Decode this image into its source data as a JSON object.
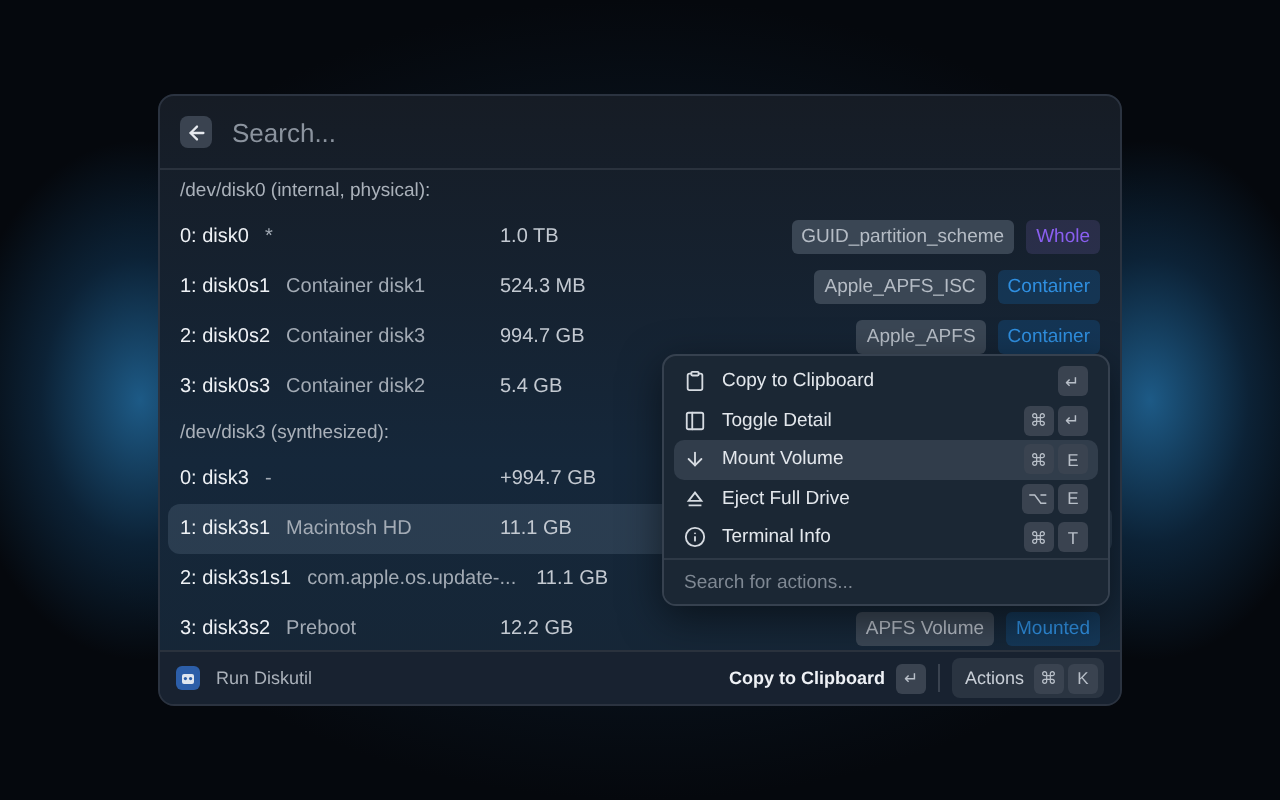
{
  "search": {
    "placeholder": "Search..."
  },
  "sections": [
    {
      "title": "/dev/disk0 (internal, physical):",
      "rows": [
        {
          "name": "0: disk0",
          "description": "*",
          "size": "1.0 TB",
          "selected": false,
          "tags": [
            {
              "label": "GUID_partition_scheme",
              "kind": "plain"
            },
            {
              "label": "Whole",
              "kind": "purple"
            }
          ]
        },
        {
          "name": "1: disk0s1",
          "description": "Container disk1",
          "size": "524.3 MB",
          "selected": false,
          "tags": [
            {
              "label": "Apple_APFS_ISC",
              "kind": "plain"
            },
            {
              "label": "Container",
              "kind": "blue"
            }
          ]
        },
        {
          "name": "2: disk0s2",
          "description": "Container disk3",
          "size": "994.7 GB",
          "selected": false,
          "tags": [
            {
              "label": "Apple_APFS",
              "kind": "plain"
            },
            {
              "label": "Container",
              "kind": "blue"
            }
          ]
        },
        {
          "name": "3: disk0s3",
          "description": "Container disk2",
          "size": "5.4 GB",
          "selected": false,
          "tags": []
        }
      ]
    },
    {
      "title": "/dev/disk3 (synthesized):",
      "rows": [
        {
          "name": "0: disk3",
          "description": "-",
          "size": "+994.7 GB",
          "selected": false,
          "tags": []
        },
        {
          "name": "1: disk3s1",
          "description": "Macintosh HD",
          "size": "11.1 GB",
          "selected": true,
          "tags": []
        },
        {
          "name": "2: disk3s1s1",
          "description": "com.apple.os.update-...",
          "size": "11.1 GB",
          "selected": false,
          "tags": []
        },
        {
          "name": "3: disk3s2",
          "description": "Preboot",
          "size": "12.2 GB",
          "selected": false,
          "tags": [
            {
              "label": "APFS Volume",
              "kind": "plain"
            },
            {
              "label": "Mounted",
              "kind": "blue"
            }
          ]
        }
      ]
    }
  ],
  "actions_menu": {
    "items": [
      {
        "label": "Copy to Clipboard",
        "kind": "clipboard",
        "selected": false,
        "keys": [
          "↵"
        ]
      },
      {
        "label": "Toggle Detail",
        "kind": "panel",
        "selected": false,
        "keys": [
          "⌘",
          "↵"
        ]
      },
      {
        "label": "Mount Volume",
        "kind": "down",
        "selected": true,
        "keys": [
          "⌘",
          "E"
        ]
      },
      {
        "label": "Eject Full Drive",
        "kind": "eject",
        "selected": false,
        "keys": [
          "⌥",
          "E"
        ]
      },
      {
        "label": "Terminal Info",
        "kind": "info",
        "selected": false,
        "keys": [
          "⌘",
          "T"
        ]
      }
    ],
    "search": {
      "placeholder": "Search for actions..."
    }
  },
  "footer": {
    "title": "Run Diskutil",
    "primary_action": {
      "label": "Copy to Clipboard",
      "keys": [
        "↵"
      ]
    },
    "actions": {
      "label": "Actions",
      "keys": [
        "⌘",
        "K"
      ]
    }
  }
}
